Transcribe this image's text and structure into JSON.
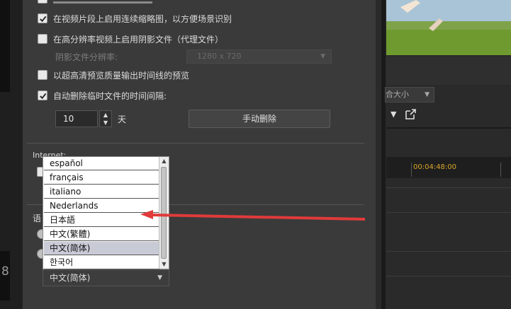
{
  "settings": {
    "items": [
      {
        "label": "在视频片段上启用连续缩略图，以方便场景识别",
        "checked": true
      },
      {
        "label": "在高分辨率视频上启用阴影文件（代理文件）",
        "checked": false
      },
      {
        "label": "以超高清预览质量输出时间线的预览",
        "checked": false
      },
      {
        "label": "自动删除临时文件的时间间隔:",
        "checked": true
      }
    ],
    "shadow_resolution_label": "阴影文件分辨率:",
    "shadow_resolution_value": "1280 x 720",
    "interval_value": "10",
    "interval_unit": "天",
    "manual_delete_label": "手动删除",
    "internet_label": "Internet:",
    "language_label": "语"
  },
  "language": {
    "options": [
      "español",
      "français",
      "italiano",
      "Nederlands",
      "日本語",
      "中文(繁體)",
      "中文(简体)",
      "한국어"
    ],
    "selected": "中文(简体)",
    "current_value": "中文(简体)"
  },
  "right_panel": {
    "fit_label": "合大小",
    "timecode": "00:04:48:00"
  },
  "left_strip": {
    "digit": "8"
  },
  "colors": {
    "dialog_bg": "#3a3a3a",
    "arrow": "#e03a3a",
    "timecode": "#d7a62a",
    "list_selected": "#c8cbd6"
  },
  "icons": [
    "checkbox-checked-icon",
    "spin-up-icon",
    "spin-down-icon",
    "dropdown-arrow-icon",
    "scroll-up-icon",
    "scroll-down-icon",
    "external-link-icon",
    "red-arrow-annotation"
  ]
}
